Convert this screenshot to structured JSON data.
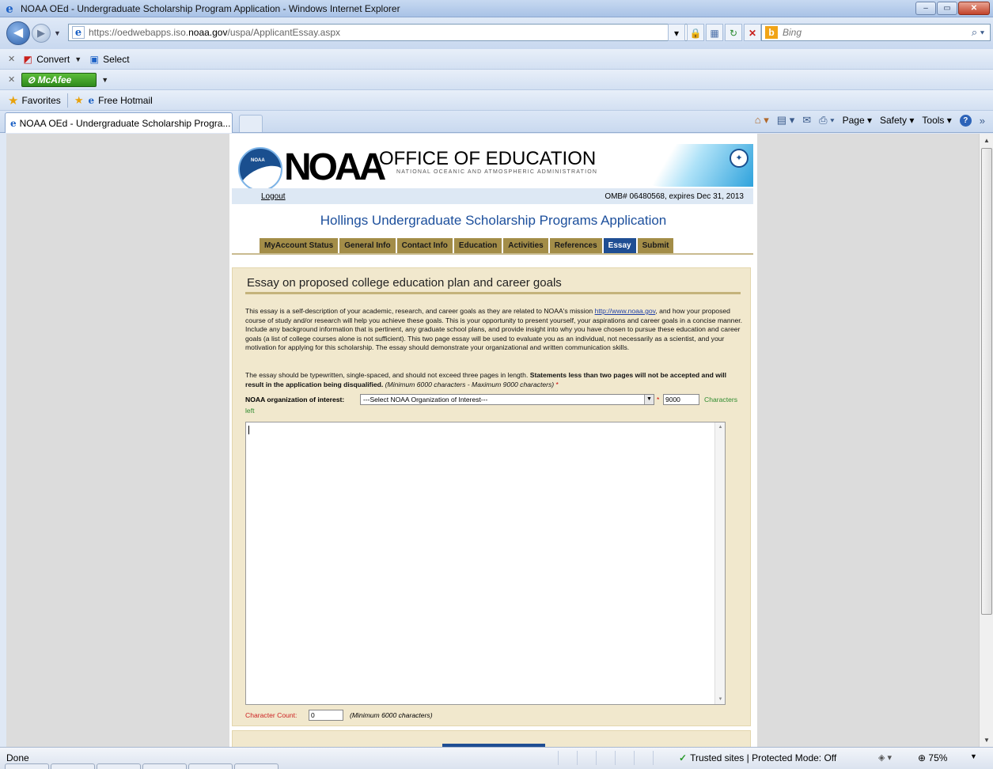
{
  "window": {
    "title": "NOAA OEd - Undergraduate Scholarship Program Application - Windows Internet Explorer",
    "buttons": {
      "minimize": "–",
      "maximize": "▭",
      "close": "✕"
    }
  },
  "address_bar": {
    "url_prefix": "https://oedwebapps.iso.",
    "url_host": "noaa.gov",
    "url_path": "/uspa/ApplicantEssay.aspx",
    "search_placeholder": "Bing"
  },
  "toolbar_convert": {
    "convert_label": "Convert",
    "select_label": "Select"
  },
  "toolbar_mcafee": {
    "label": "McAfee"
  },
  "favorites_bar": {
    "favorites_label": "Favorites",
    "hotmail_label": "Free Hotmail"
  },
  "tabs": {
    "active_tab": "NOAA OEd - Undergraduate Scholarship Progra..."
  },
  "command_bar": {
    "page": "Page ▾",
    "safety": "Safety ▾",
    "tools": "Tools ▾"
  },
  "header": {
    "noaa_word": "NOAA",
    "logo_text": "NOAA",
    "office_title": "OFFICE OF EDUCATION",
    "office_subtitle": "NATIONAL OCEANIC AND ATMOSPHERIC ADMINISTRATION",
    "logout": "Logout",
    "omb": "OMB# 06480568, expires Dec 31, 2013"
  },
  "app_title": "Hollings Undergraduate Scholarship Programs Application",
  "nav_tabs": [
    {
      "label": "MyAccount Status",
      "active": false
    },
    {
      "label": "General Info",
      "active": false
    },
    {
      "label": "Contact Info",
      "active": false
    },
    {
      "label": "Education",
      "active": false
    },
    {
      "label": "Activities",
      "active": false
    },
    {
      "label": "References",
      "active": false
    },
    {
      "label": "Essay",
      "active": true
    },
    {
      "label": "Submit",
      "active": false
    }
  ],
  "essay_section": {
    "title": "Essay on proposed college education plan and career goals",
    "desc_part1": "This essay is a self-description of your academic, research, and career goals as they are related to NOAA's mission ",
    "desc_link": "http://www.noaa.gov",
    "desc_part2": ", and how your proposed course of study and/or research will help you achieve these goals. This is your opportunity to present yourself, your aspirations and career goals in a concise manner. Include any background information that is pertinent, any graduate school plans, and provide insight into why you have chosen to pursue these education and career goals (a list of college courses alone is not sufficient). This two page essay will be used to evaluate you as an individual, not necessarily as a scientist, and your motivation for applying for this scholarship. The essay should demonstrate your organizational and written communication skills.",
    "format_text": "The essay should be typewritten, single-spaced, and should not exceed three pages in length. ",
    "format_bold": "Statements less than two pages will not be accepted and will result in the application being disqualified.",
    "format_italic": " (Minimum 6000 characters - Maximum 9000 characters)",
    "required_mark": "*",
    "org_label": "NOAA organization of interest:",
    "org_selected": "---Select NOAA Organization of Interest---",
    "chars_value": "9000",
    "chars_label": "Characters",
    "chars_left": "left",
    "essay_value": "",
    "count_label": "Character Count:",
    "count_value": "0",
    "count_min": "(Minimum 6000 characters)"
  },
  "status_bar": {
    "status": "Done",
    "zone": "Trusted sites | Protected Mode: Off",
    "zoom": "75%"
  }
}
